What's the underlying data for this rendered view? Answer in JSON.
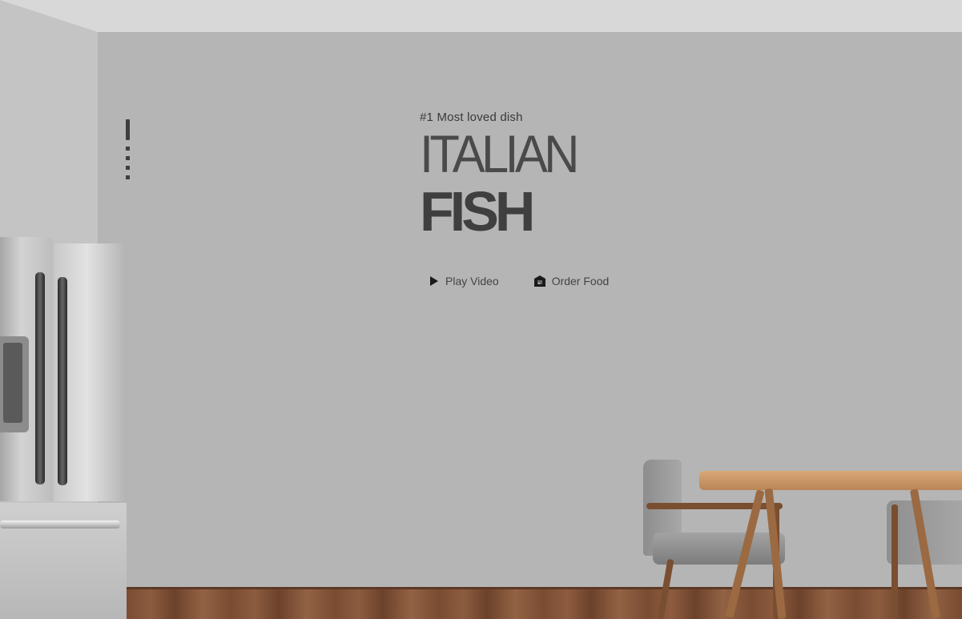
{
  "hero": {
    "tagline": "#1 Most loved dish",
    "title_line1": "ITALIAN",
    "title_line2": "FISH"
  },
  "actions": {
    "play_label": "Play Video",
    "order_label": "Order Food"
  },
  "icons": {
    "play": "play-icon",
    "order": "restaurant-icon"
  },
  "slide_indicator": {
    "total": 5,
    "active": 1
  },
  "colors": {
    "wall": "#b5b5b5",
    "text": "#444444"
  }
}
